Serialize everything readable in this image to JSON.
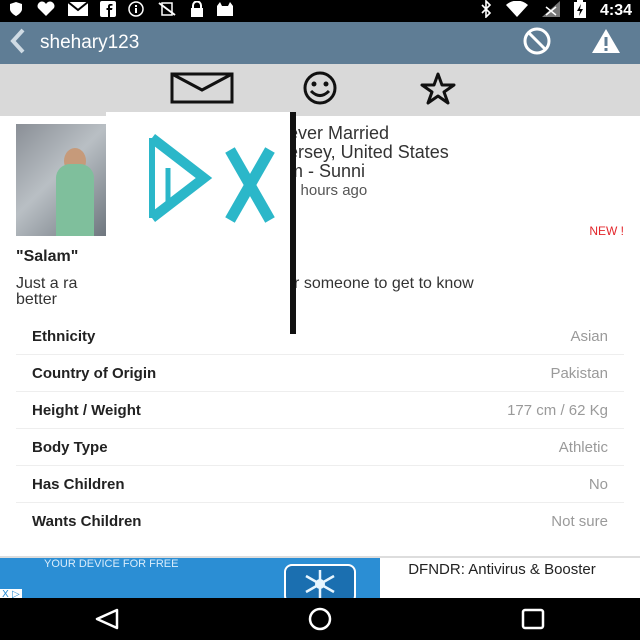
{
  "status_bar": {
    "time": "4:34",
    "icons": [
      "shield-icon",
      "heart-icon",
      "mail-icon",
      "facebook-icon",
      "info-icon",
      "no-sim-icon",
      "lock-icon",
      "cat-icon",
      "bluetooth-icon",
      "wifi-icon",
      "signal-icon",
      "battery-icon"
    ]
  },
  "appbar": {
    "title": "shehary123",
    "back_icon": "back-chevron-icon",
    "block_icon": "block-icon",
    "report_icon": "warning-icon",
    "color": "#5f7d95"
  },
  "actions": {
    "items": [
      {
        "icon": "mail-icon"
      },
      {
        "icon": "smiley-icon"
      },
      {
        "icon": "star-icon"
      }
    ]
  },
  "profile": {
    "status": "ever Married",
    "location": "ersey, United States",
    "religion": "m - Sunni",
    "last_seen": "7 hours ago",
    "link_fragment": "p",
    "new_badge": "NEW !",
    "headline": "\"Salam\"",
    "about_part1": "Just a ra",
    "about_part2": "g for someone to get to know",
    "about_part3": "better"
  },
  "details": {
    "rows": [
      {
        "label": "Ethnicity",
        "value": "Asian"
      },
      {
        "label": "Country of Origin",
        "value": "Pakistan"
      },
      {
        "label": "Height / Weight",
        "value": "177 cm / 62 Kg"
      },
      {
        "label": "Body Type",
        "value": "Athletic"
      },
      {
        "label": "Has Children",
        "value": "No"
      },
      {
        "label": "Wants Children",
        "value": "Not sure"
      }
    ]
  },
  "ad": {
    "banner_text": "YOUR DEVICE FOR FREE",
    "title": "DFNDR: Antivirus & Booster",
    "corner": "X ▷"
  },
  "nav": {
    "back_icon": "nav-back-icon",
    "home_icon": "nav-home-icon",
    "recents_icon": "nav-recents-icon"
  }
}
